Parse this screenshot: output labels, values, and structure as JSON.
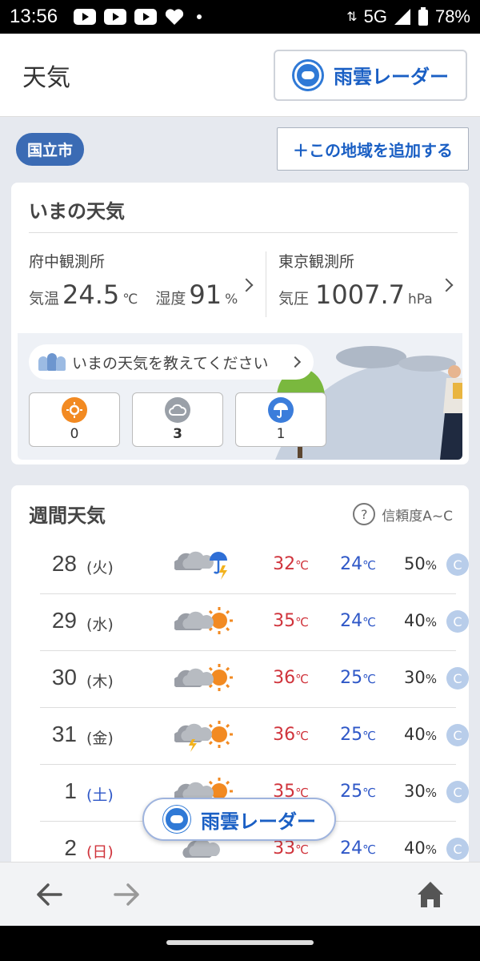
{
  "status_bar": {
    "time": "13:56",
    "network": "5G",
    "battery": "78%"
  },
  "header": {
    "title": "天気",
    "radar_button_label": "雨雲レーダー"
  },
  "location": {
    "name": "国立市",
    "add_button_label": "＋この地域を追加する"
  },
  "now": {
    "title": "いまの天気",
    "station1": {
      "name": "府中観測所",
      "temp_label": "気温",
      "temp_value": "24.5",
      "temp_unit": "℃",
      "humidity_label": "湿度",
      "humidity_value": "91",
      "humidity_unit": "%"
    },
    "station2": {
      "name": "東京観測所",
      "pressure_label": "気圧",
      "pressure_value": "1007.7",
      "pressure_unit": "hPa"
    },
    "ask_label": "いまの天気を教えてください",
    "votes": [
      {
        "icon": "sun-icon",
        "count": "0"
      },
      {
        "icon": "cloud-icon",
        "count": "3"
      },
      {
        "icon": "umbrella-icon",
        "count": "1"
      }
    ]
  },
  "weekly": {
    "title": "週間天気",
    "reliability_label": "信頼度A~C",
    "days": [
      {
        "date": "28",
        "dow": "(火)",
        "icon": "cloud-rain-thunder-icon",
        "high": "32",
        "low": "24",
        "pop": "50",
        "rel": "C"
      },
      {
        "date": "29",
        "dow": "(水)",
        "icon": "cloud-sun-icon",
        "high": "35",
        "low": "24",
        "pop": "40",
        "rel": "C"
      },
      {
        "date": "30",
        "dow": "(木)",
        "icon": "cloud-sun-icon",
        "high": "36",
        "low": "25",
        "pop": "30",
        "rel": "C"
      },
      {
        "date": "31",
        "dow": "(金)",
        "icon": "thunder-sun-icon",
        "high": "36",
        "low": "25",
        "pop": "40",
        "rel": "C"
      },
      {
        "date": "1",
        "dow": "(土)",
        "icon": "cloud-sun-icon",
        "high": "35",
        "low": "25",
        "pop": "30",
        "rel": "C"
      },
      {
        "date": "2",
        "dow": "(日)",
        "icon": "cloud-icon",
        "high": "33",
        "low": "24",
        "pop": "40",
        "rel": "C"
      }
    ],
    "temp_unit": "℃",
    "pop_unit": "%"
  },
  "floating_radar_label": "雨雲レーダー",
  "colors": {
    "accent": "#1a5fc4",
    "high": "#d0343c",
    "low": "#2e57c7",
    "saturday": "#2e57c7",
    "sunday": "#d0343c",
    "badge": "#3b6bb4"
  }
}
